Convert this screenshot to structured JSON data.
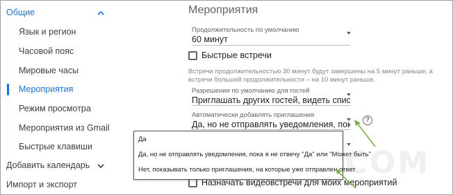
{
  "sidebar": {
    "groups": [
      {
        "label": "Общие",
        "expanded": true
      },
      {
        "label": "Добавить календарь",
        "expanded": false
      },
      {
        "label": "Импорт и экспорт"
      }
    ],
    "items": [
      {
        "label": "Язык и регион"
      },
      {
        "label": "Часовой пояс"
      },
      {
        "label": "Мировые часы"
      },
      {
        "label": "Мероприятия",
        "active": true
      },
      {
        "label": "Режим просмотра"
      },
      {
        "label": "Мероприятия из Gmail"
      },
      {
        "label": "Быстрые клавиши"
      }
    ]
  },
  "main": {
    "section_title": "Мероприятия",
    "default_duration": {
      "label": "Продолжительность по умолчанию",
      "value": "60 минут"
    },
    "speedy_meetings": {
      "label": "Быстрые встречи",
      "checked": false
    },
    "speedy_hint": "Встречи продолжительностью 30 минут будут завершены на 5 минут раньше, а встречи большей продолжительности – на 10 минут раньше.",
    "default_permissions": {
      "label": "Разрешения по умолчанию для гостей",
      "value": "Приглашать других гостей, видеть список пригл..."
    },
    "auto_add_invitations": {
      "label": "Автоматически добавлять приглашения",
      "value": "Да, но не отправлять уведомления, пока я не о..."
    },
    "help_icon_text": "?",
    "video_meetings": {
      "label": "Назначать видеовстречи для моих мероприятий",
      "checked": false
    }
  },
  "dropdown": {
    "options": [
      "Да",
      "Да, но не отправлять уведомления, пока я не отвечу \"Да\" или \"Может быть\"",
      "Нет, показывать только приглашения, на которые уже отправлен ответ"
    ]
  },
  "watermark_text": "KOMPKIA.COM",
  "colors": {
    "accent": "#1a73e8",
    "annotation_arrow": "#7cb342",
    "text": "#3c4043"
  },
  "icons": [
    "chevron-up-icon",
    "chevron-down-icon",
    "dropdown-arrow-icon",
    "help-icon",
    "checkbox-icon"
  ]
}
